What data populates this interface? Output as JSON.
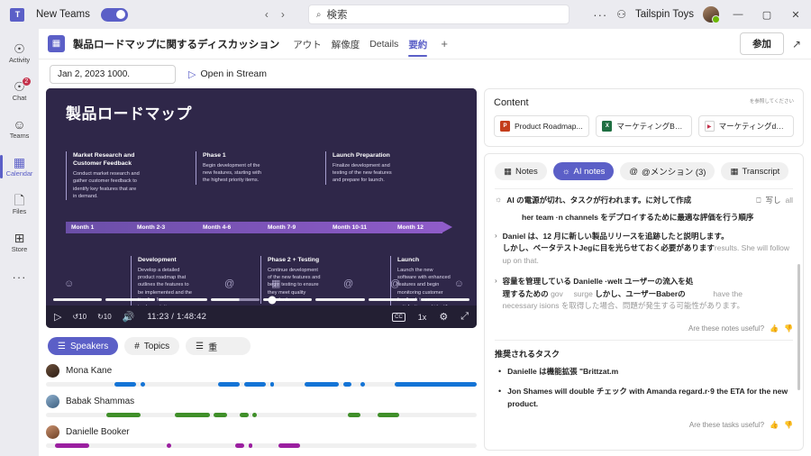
{
  "titlebar": {
    "app_name": "New Teams",
    "toggle_on": true,
    "nav_back": "‹",
    "nav_forward": "›",
    "search_placeholder": "検索",
    "search_icon": "search-icon",
    "overflow": "···",
    "tenant": "Tailspin Toys",
    "minimize": "—",
    "maximize": "▢",
    "close": "✕"
  },
  "meeting": {
    "title": "製品ロードマップに関するディスカッション",
    "tabs": [
      {
        "label": "アウト",
        "selected": false
      },
      {
        "label": "解像度",
        "selected": false
      },
      {
        "label": "Details",
        "selected": false
      },
      {
        "label": "要約",
        "selected": true
      }
    ],
    "add_tab": "+",
    "join_label": "参加",
    "popout_icon": "pop-out-icon"
  },
  "subbar": {
    "date_value": "Jan 2, 2023 1000.",
    "stream_link": "Open in Stream"
  },
  "sidebar": {
    "items": [
      {
        "label": "Activity",
        "icon": "bell-icon",
        "badge": "",
        "selected": false
      },
      {
        "label": "Chat",
        "icon": "chat-icon",
        "badge": "2",
        "selected": false
      },
      {
        "label": "Teams",
        "icon": "teams-icon",
        "badge": "",
        "selected": false
      },
      {
        "label": "Calendar",
        "icon": "calendar-icon",
        "badge": "",
        "selected": true
      },
      {
        "label": "Files",
        "icon": "file-icon",
        "badge": "",
        "selected": false
      },
      {
        "label": "Store",
        "icon": "store-plus-icon",
        "badge": "",
        "selected": false
      }
    ],
    "more": "···"
  },
  "video": {
    "slide_title": "製品ロードマップ",
    "phases": [
      {
        "heading": "Market Research and Customer Feedback",
        "body": "Conduct market research and gather customer feedback to identify key features that are in demand."
      },
      {
        "heading": "Phase 1",
        "body": "Begin development of the new features, starting with the highest priority items."
      },
      {
        "heading": "Launch Preparation",
        "body": "Finalize development and testing of the new features and prepare for launch."
      },
      {
        "heading": "Development",
        "body": "Develop a detailed product roadmap that outlines the features to be implemented and the timeline for implementation."
      },
      {
        "heading": "Phase 2 + Testing",
        "body": "Continue development of the new features and begin testing to ensure they meet quality standards."
      },
      {
        "heading": "Launch",
        "body": "Launch the new software with enhanced features and begin monitoring customer feedback to ensure satisfaction and identify areas for improvement."
      }
    ],
    "months": [
      "Month 1",
      "Month 2-3",
      "Month 4-6",
      "Month 7-9",
      "Month 10-11",
      "Month 12"
    ],
    "controls": {
      "play": "▷",
      "rewind": "↺10",
      "forward": "↻10",
      "volume": "🔊",
      "time": "11:23 / 1:48:42",
      "captions": "CC",
      "speed": "1x",
      "settings": "⚙",
      "fullscreen": "⤢"
    },
    "progress_percent": 52
  },
  "speakers_panel": {
    "chips": [
      {
        "label": "Speakers",
        "icon": "speakers-icon",
        "selected": true
      },
      {
        "label": "Topics",
        "icon": "hash-icon",
        "selected": false
      },
      {
        "label": "重",
        "icon": "list-icon",
        "selected": false
      }
    ],
    "speakers": [
      {
        "name": "Mona Kane",
        "color": "#1474d6",
        "avatar_from": "#6b4f3a",
        "avatar_to": "#2e1f16",
        "segments": [
          [
            16,
            5
          ],
          [
            22,
            1
          ],
          [
            40,
            5
          ],
          [
            45,
            5
          ],
          [
            51,
            1
          ],
          [
            60,
            8
          ],
          [
            69,
            2
          ],
          [
            73,
            1
          ],
          [
            81,
            26
          ]
        ]
      },
      {
        "name": "Babak Shammas",
        "color": "#3f8f29",
        "avatar_from": "#7fa3c4",
        "avatar_to": "#3c5f80",
        "segments": [
          [
            14,
            8
          ],
          [
            30,
            8
          ],
          [
            39,
            3
          ],
          [
            45,
            2
          ],
          [
            48,
            1
          ],
          [
            70,
            3
          ],
          [
            77,
            5
          ]
        ]
      },
      {
        "name": "Danielle Booker",
        "color": "#9b1fa0",
        "avatar_from": "#c38b6e",
        "avatar_to": "#6d4126",
        "segments": [
          [
            2,
            8
          ],
          [
            28,
            1
          ],
          [
            44,
            2
          ],
          [
            47,
            1
          ],
          [
            54,
            5
          ]
        ]
      }
    ]
  },
  "content_panel": {
    "heading": "Content",
    "note": "を参照してください",
    "files": [
      {
        "name": "Product Roadmap...",
        "type": "ppt",
        "glyph": "P"
      },
      {
        "name": "マーケティングBudget...",
        "type": "xls",
        "glyph": "X"
      },
      {
        "name": "マーケティングdemo...",
        "type": "vid",
        "glyph": "▶"
      }
    ]
  },
  "notes_panel": {
    "tabs": [
      {
        "label": "Notes",
        "icon": "notes-icon",
        "selected": false
      },
      {
        "label": "AI notes",
        "icon": "bulb-icon",
        "selected": true
      },
      {
        "label": "@メンション (3)",
        "icon": "mention-icon",
        "selected": false
      },
      {
        "label": "Transcript",
        "icon": "transcript-icon",
        "selected": false
      }
    ],
    "ai_header": "AI の電源が切れ、タスクが行われます。に対して作成",
    "ai_header_actions": {
      "copy_icon": "copy-icon",
      "copy_label": "写し",
      "all_label": "all"
    },
    "ai_subheader": "her team ·n channels をデプロイするために最適な評価を行う順序",
    "notes": [
      {
        "lead": "Daniel は、12 月に新しい製品リリースを追跡したと説明します。",
        "body_jp": "しかし、ベータテストJegに目を光らせておく必要があります",
        "body_en": "results. She will follow up on that."
      },
      {
        "lead": "容量を管理している Danielle ·welt ユーザーの流入を処",
        "body_jp": "理するための",
        "mid_en_1": "gov",
        "mid_en_2": "surge",
        "body_jp_2": "しかし、ユーザーBaberの",
        "mid_en_3": "have the",
        "body_jp_3": "necessary isions を取得した場合、問題が発生する可能性があります。"
      }
    ],
    "notes_feedback": "Are these notes useful?",
    "tasks_heading": "推奨されるタスク",
    "tasks": [
      "Danielle は機能拡張 \"Brittzat.m",
      "Jon Shames will double チェック with Amanda regard.r·9 the ETA    for the new product."
    ],
    "tasks_feedback": "Are these tasks useful?",
    "thumbs_up_icon": "thumbs-up-icon",
    "thumbs_down_icon": "thumbs-down-icon"
  },
  "colors": {
    "accent": "#5b5fc7",
    "badge_red": "#c4314b",
    "slide_bg": "#2f2749",
    "player_bg": "#231f33"
  }
}
